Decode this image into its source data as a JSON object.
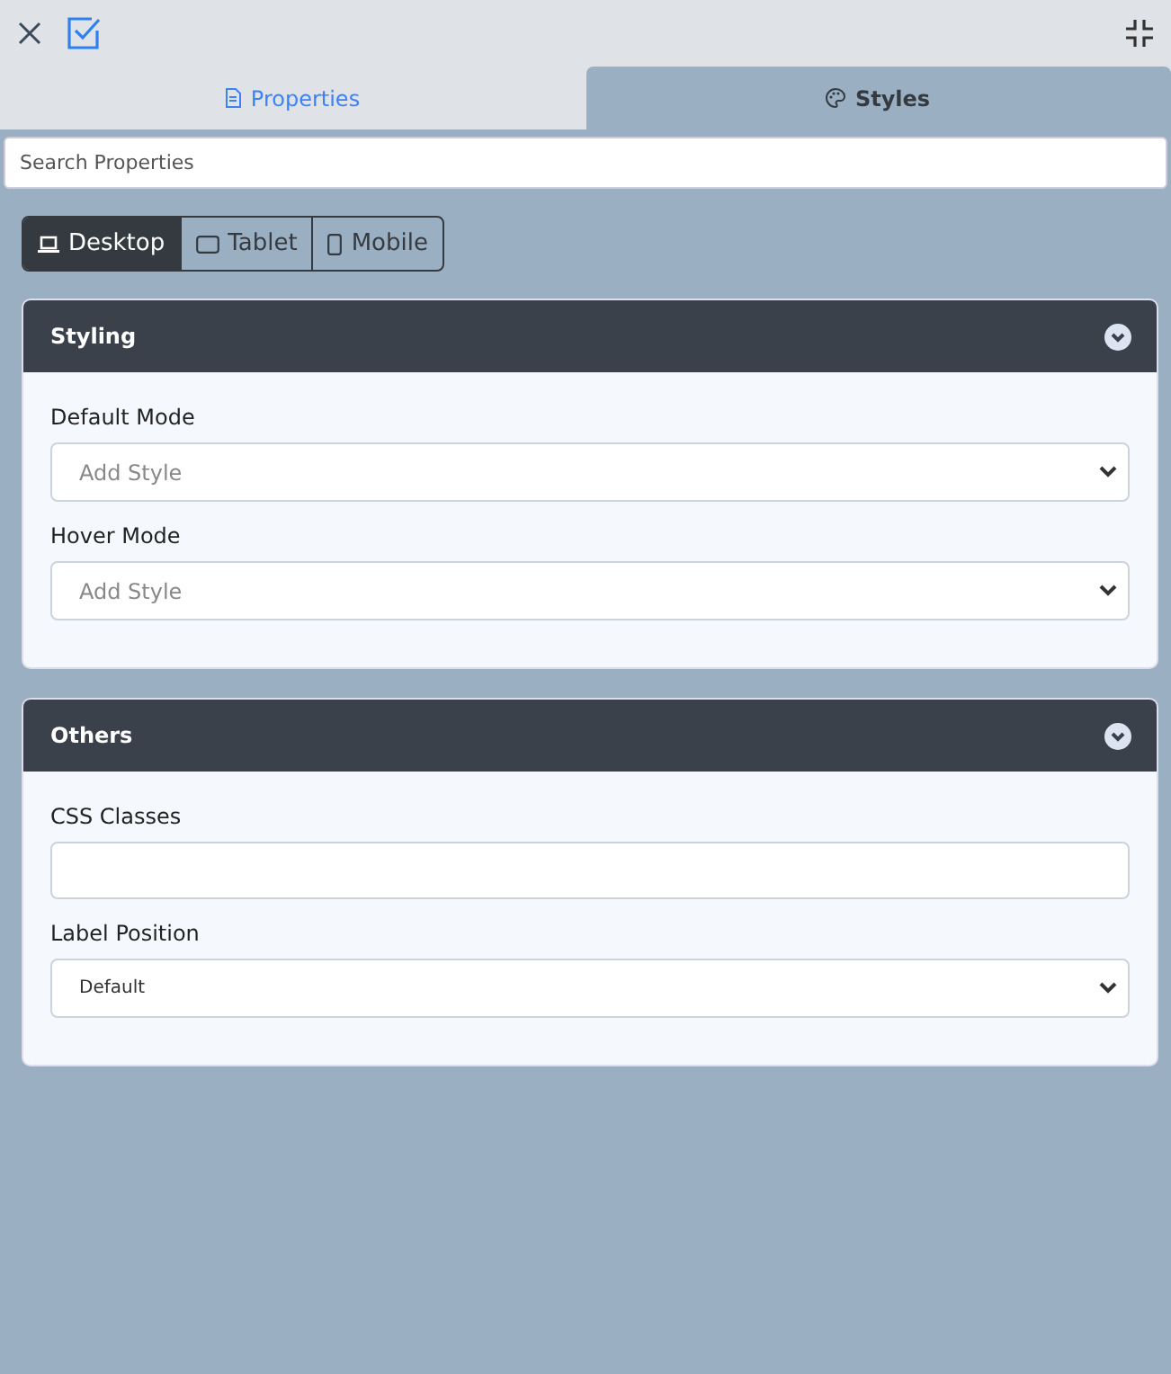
{
  "tabs": [
    {
      "label": "Properties",
      "selected": false
    },
    {
      "label": "Styles",
      "selected": true
    }
  ],
  "search": {
    "placeholder": "Search Properties"
  },
  "devices": [
    {
      "label": "Desktop",
      "kind": "laptop",
      "selected": true
    },
    {
      "label": "Tablet",
      "kind": "tablet",
      "selected": false
    },
    {
      "label": "Mobile",
      "kind": "phone",
      "selected": false
    }
  ],
  "sections": [
    {
      "title": "Styling",
      "fields": [
        {
          "label": "Default Mode",
          "kind": "select",
          "placeholder": "Add Style"
        },
        {
          "label": "Hover Mode",
          "kind": "select",
          "placeholder": "Add Style"
        }
      ]
    },
    {
      "title": "Others",
      "fields": [
        {
          "label": "CSS Classes",
          "kind": "text"
        },
        {
          "label": "Label Position",
          "kind": "select",
          "value": "Default"
        }
      ]
    }
  ]
}
